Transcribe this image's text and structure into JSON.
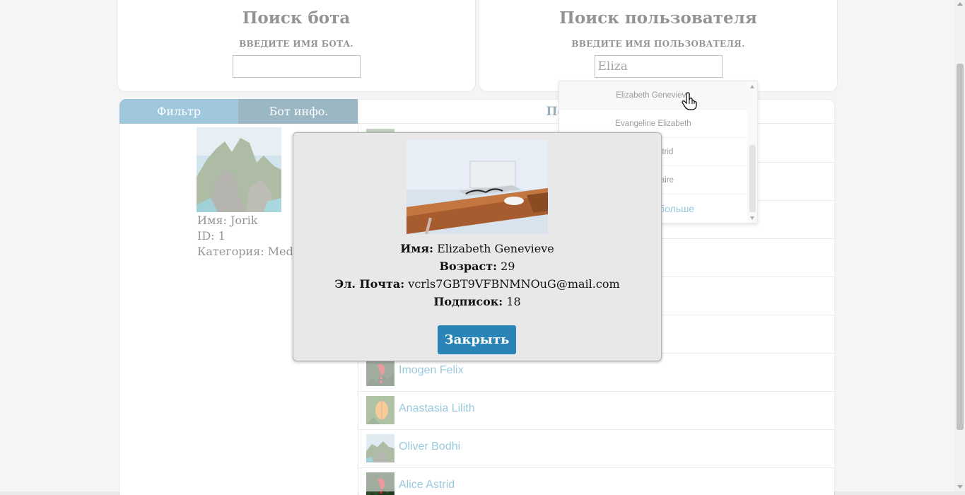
{
  "bot_search": {
    "title": "Поиск бота",
    "hint": "ВВЕДИТЕ ИМЯ БОТА.",
    "value": ""
  },
  "user_search": {
    "title": "Поиск пользователя",
    "hint": "ВВЕДИТЕ ИМЯ ПОЛЬЗОВАТЕЛЯ.",
    "value": "Eliza"
  },
  "tabs": {
    "filter": "Фильтр",
    "bot_info": "Бот инфо."
  },
  "bot": {
    "name_line": "Имя: Jorik",
    "id_line": "ID: 1",
    "category_line": "Категория: Media"
  },
  "users_panel": {
    "title": "Пользователи"
  },
  "users": [
    {
      "name": "Imogen Felix"
    },
    {
      "name": "Anastasia Lilith"
    },
    {
      "name": "Oliver Bodhi"
    },
    {
      "name": "Alice Astrid"
    }
  ],
  "dropdown": {
    "items": [
      "Elizabeth Genevieve",
      "Evangeline Elizabeth",
      "Eliza Astrid",
      "Eliza Claire"
    ],
    "more": "Смотреть больше"
  },
  "modal": {
    "name_label": "Имя:",
    "name_value": "Elizabeth Genevieve",
    "age_label": "Возраст:",
    "age_value": "29",
    "email_label": "Эл. Почта:",
    "email_value": "vcrls7GBT9VFBNMNOuG@mail.com",
    "subs_label": "Подписок:",
    "subs_value": "18",
    "close": "Закрыть"
  },
  "colors": {
    "accent": "#2a85b6",
    "accent_dark": "#1f5f7b",
    "link": "#1a88b3"
  }
}
